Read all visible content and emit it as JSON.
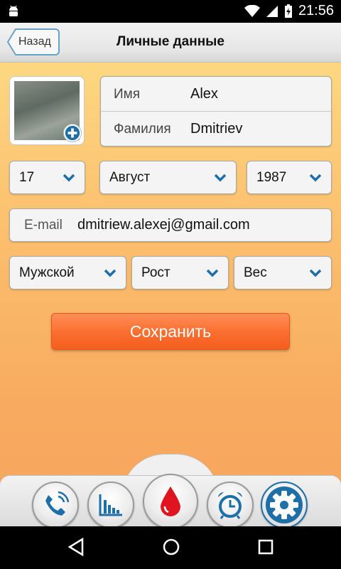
{
  "status_bar": {
    "time": "21:56"
  },
  "header": {
    "back_label": "Назад",
    "title": "Личные данные"
  },
  "profile": {
    "first_name_label": "Имя",
    "first_name_value": "Alex",
    "last_name_label": "Фамилия",
    "last_name_value": "Dmitriev"
  },
  "birth_date": {
    "day": "17",
    "month": "Август",
    "year": "1987"
  },
  "email": {
    "label": "E-mail",
    "value": "dmitriew.alexej@gmail.com"
  },
  "body": {
    "gender": "Мужской",
    "height_placeholder": "Рост",
    "weight_placeholder": "Вес"
  },
  "save_label": "Сохранить",
  "tabs": [
    {
      "icon": "phone-icon"
    },
    {
      "icon": "chart-icon"
    },
    {
      "icon": "blood-drop-icon"
    },
    {
      "icon": "alarm-clock-icon"
    },
    {
      "icon": "gear-icon"
    }
  ],
  "colors": {
    "accent": "#1e6fa8",
    "save_button": "#fb6d2e",
    "drop": "#e0141e"
  }
}
